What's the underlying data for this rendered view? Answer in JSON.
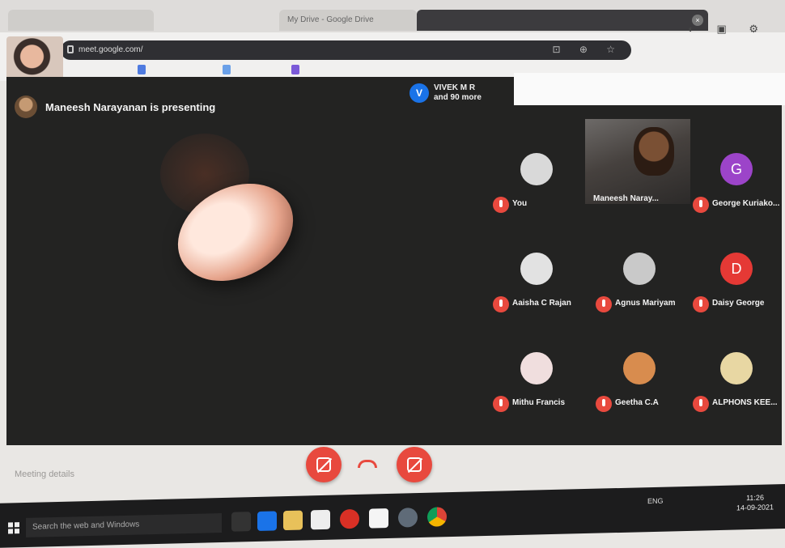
{
  "browser": {
    "tabs": [
      {
        "label": "",
        "active": false
      },
      {
        "label": "My Drive - Google Drive",
        "active": false
      },
      {
        "label": "",
        "active": true
      }
    ],
    "url": "meet.google.com/",
    "url_icons": "⊡ ⊕ ☆",
    "toolbar_icons": "◐ ▣ ⚙"
  },
  "meeting": {
    "presenter_text": "Maneesh Narayanan is presenting",
    "viewers": {
      "initial": "V",
      "name": "VIVEK M R",
      "more": "and 90 more"
    },
    "participants": [
      {
        "name": "You",
        "initial": "",
        "avatar_color": "#d9d9d9"
      },
      {
        "name": "Maneesh Naray...",
        "initial": "",
        "avatar_color": "#4e3d32",
        "video": true
      },
      {
        "name": "George Kuriako...",
        "initial": "G",
        "avatar_color": "#9c44c9"
      },
      {
        "name": "Aaisha C Rajan",
        "initial": "",
        "avatar_color": "#e2e2e2"
      },
      {
        "name": "Agnus Mariyam",
        "initial": "",
        "avatar_color": "#c9c9c9"
      },
      {
        "name": "Daisy George",
        "initial": "D",
        "avatar_color": "#e53935"
      },
      {
        "name": "Mithu Francis",
        "initial": "",
        "avatar_color": "#f0dede"
      },
      {
        "name": "Geetha C.A",
        "initial": "",
        "avatar_color": "#d88c4e"
      },
      {
        "name": "ALPHONS KEE...",
        "initial": "",
        "avatar_color": "#e8d7a3"
      }
    ],
    "meeting_details_label": "Meeting details",
    "accent": "#e8493e"
  },
  "taskbar": {
    "search_placeholder": "Search the web and Windows",
    "tray_lang": "ENG",
    "time": "11:26",
    "date": "14-09-2021"
  }
}
